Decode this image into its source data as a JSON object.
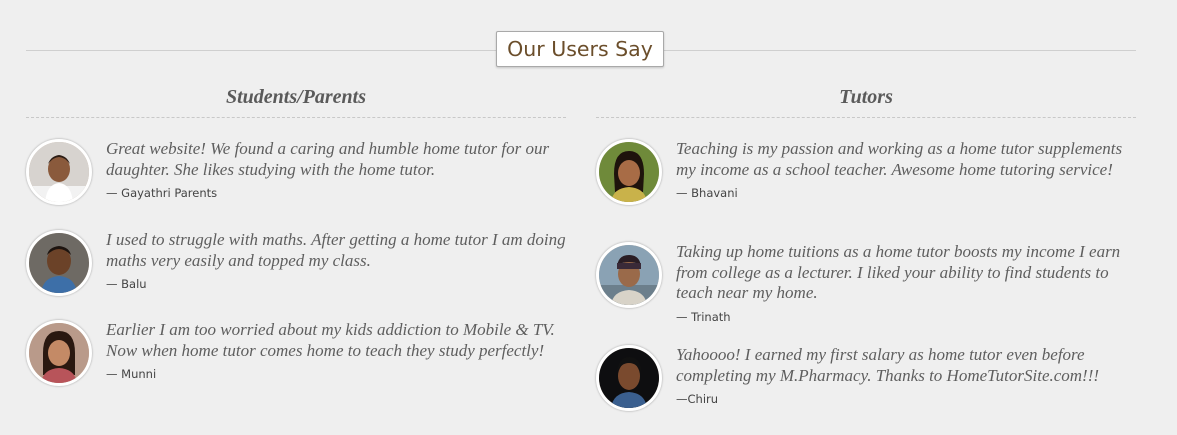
{
  "section": {
    "title": "Our Users Say"
  },
  "students": {
    "heading": "Students/Parents",
    "items": [
      {
        "quote": "Great website! We found a caring and humble home tutor for our daughter. She likes studying with the home tutor.",
        "author": "— Gayathri Parents",
        "avatar_icon": "user-photo"
      },
      {
        "quote": "I used to struggle with maths. After getting a home tutor I am doing maths very easily and topped my class.",
        "author": "— Balu",
        "avatar_icon": "user-photo"
      },
      {
        "quote": "Earlier I am too worried about my kids addiction to Mobile & TV. Now when home tutor comes home to teach they study perfectly!",
        "author": "— Munni",
        "avatar_icon": "user-photo"
      }
    ]
  },
  "tutors": {
    "heading": "Tutors",
    "items": [
      {
        "quote": "Teaching is my passion and working as a home tutor supplements my income as a school teacher. Awesome home tutoring service!",
        "author": "— Bhavani",
        "avatar_icon": "user-photo"
      },
      {
        "quote": "Taking up home tuitions as a home tutor boosts my income I earn from college as a lecturer. I liked your ability to find students to teach near my home.",
        "author": "— Trinath",
        "avatar_icon": "user-photo"
      },
      {
        "quote": "Yahoooo! I earned my first salary as home tutor even before completing my M.Pharmacy. Thanks to HomeTutorSite.com!!!",
        "author": "—Chiru",
        "avatar_icon": "user-photo"
      }
    ]
  },
  "colors": {
    "background": "#efefef",
    "title_text": "#6b4e2b",
    "quote_text": "#5e5e5e"
  }
}
